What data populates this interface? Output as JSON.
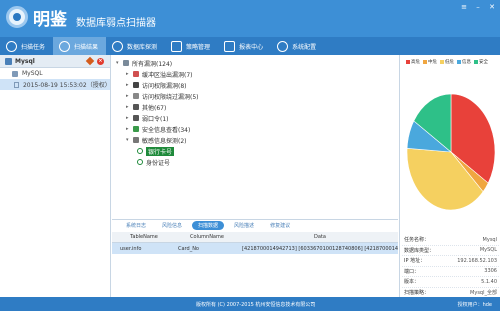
{
  "app": {
    "name": "明鉴",
    "subtitle": "数据库弱点扫描器"
  },
  "toolbar": {
    "items": [
      {
        "label": "扫描任务",
        "icon": "scan-task-icon"
      },
      {
        "label": "扫描结果",
        "icon": "scan-result-icon"
      },
      {
        "label": "数据库探测",
        "icon": "db-probe-icon"
      },
      {
        "label": "策略管理",
        "icon": "policy-icon"
      },
      {
        "label": "报表中心",
        "icon": "report-icon"
      },
      {
        "label": "系统配置",
        "icon": "settings-icon"
      }
    ]
  },
  "left": {
    "header": "Mysql",
    "items": [
      {
        "label": "MySQL"
      },
      {
        "label": "2015-08-19 15:53:02（授权）"
      }
    ]
  },
  "tree": {
    "root": "所有漏洞(124)",
    "nodes": [
      {
        "label": "缓冲区溢出漏洞(7)",
        "color": "#d05050"
      },
      {
        "label": "访问权限漏洞(8)",
        "color": "#444"
      },
      {
        "label": "访问权限绕过漏洞(5)",
        "color": "#888"
      },
      {
        "label": "其他(67)",
        "color": "#555"
      },
      {
        "label": "弱口令(1)",
        "color": "#555"
      },
      {
        "label": "安全信息查看(34)",
        "color": "#3a9a4a"
      },
      {
        "label": "敏感信息探测(2)",
        "color": "#777"
      }
    ],
    "children": [
      {
        "label": "银行卡号"
      },
      {
        "label": "身份证号"
      }
    ]
  },
  "tabs": [
    {
      "label": "系统日志"
    },
    {
      "label": "风险信息"
    },
    {
      "label": "扫描数据"
    },
    {
      "label": "风险描述"
    },
    {
      "label": "修复建议"
    }
  ],
  "table": {
    "headers": [
      "TableName",
      "ColumnName",
      "Data"
    ],
    "rows": [
      {
        "table": "user.info",
        "column": "Card_No",
        "data": "[4218700014942713] [6033670100128740806] [4218700014942..."
      }
    ]
  },
  "legend": [
    {
      "label": "高危",
      "color": "#e8413a"
    },
    {
      "label": "中危",
      "color": "#f0a640"
    },
    {
      "label": "低危",
      "color": "#f5d060"
    },
    {
      "label": "信息",
      "color": "#4aa8dd"
    },
    {
      "label": "安全",
      "color": "#2ec088"
    }
  ],
  "chart_data": {
    "type": "pie",
    "series": [
      {
        "name": "高危",
        "value": 34
      },
      {
        "name": "中危",
        "value": 3
      },
      {
        "name": "低危",
        "value": 39
      },
      {
        "name": "信息",
        "value": 8
      },
      {
        "name": "安全",
        "value": 16
      }
    ]
  },
  "info": [
    {
      "label": "任务名称：",
      "value": "Mysql"
    },
    {
      "label": "数据库类型：",
      "value": "MySQL"
    },
    {
      "label": "IP 地址：",
      "value": "192.168.52.103"
    },
    {
      "label": "端口：",
      "value": "3306"
    },
    {
      "label": "版本：",
      "value": "5.1.40"
    },
    {
      "label": "扫描策略：",
      "value": "Mysql_全部"
    }
  ],
  "status": {
    "copyright": "版权所有 (C) 2007-2015 杭州安恒信息技术有限公司",
    "license": "授权用户：hde"
  }
}
